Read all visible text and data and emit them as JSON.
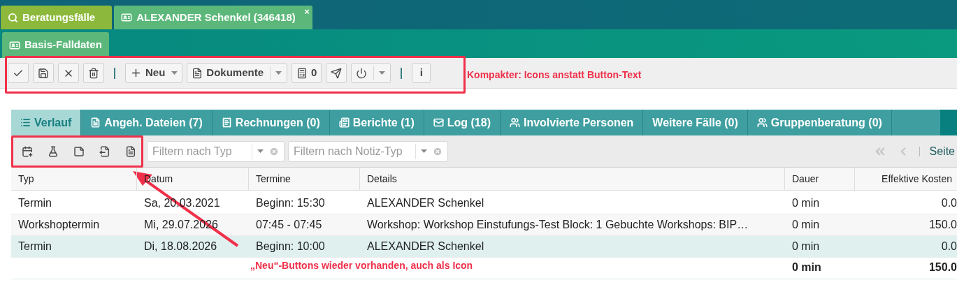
{
  "top_tabs": [
    {
      "label": "Beratungsfälle",
      "color": "#8cb93b"
    },
    {
      "label": "ALEXANDER Schenkel (346418)",
      "color": "#5cb87a",
      "close": "×"
    }
  ],
  "sub_tab": {
    "label": "Basis-Falldaten"
  },
  "toolbar": [
    {
      "kind": "button"
    },
    {
      "kind": "button"
    },
    {
      "kind": "button"
    },
    {
      "kind": "button"
    },
    {
      "kind": "separator"
    },
    {
      "kind": "dropdown",
      "label": "Neu"
    },
    {
      "kind": "split",
      "label": "Dokumente"
    },
    {
      "kind": "button",
      "label": "0"
    },
    {
      "kind": "button"
    },
    {
      "kind": "split"
    },
    {
      "kind": "separator"
    },
    {
      "kind": "button",
      "label": "i"
    }
  ],
  "section_tabs": [
    {
      "label": "Verlauf",
      "selected": true
    },
    {
      "label": "Angeh. Dateien (7)",
      "selected": false
    },
    {
      "label": "Rechnungen (0)",
      "selected": false
    },
    {
      "label": "Berichte (1)",
      "selected": false
    },
    {
      "label": "Log (18)",
      "selected": false
    },
    {
      "label": "Involvierte Personen",
      "selected": false
    },
    {
      "label": "Weitere Fälle (0)",
      "selected": false
    },
    {
      "label": "Gruppenberatung (0)",
      "selected": false
    }
  ],
  "filters": [
    {
      "placeholder": "Filtern nach Typ"
    },
    {
      "placeholder": "Filtern nach Notiz-Typ"
    }
  ],
  "paging": {
    "label": "Seite"
  },
  "table": {
    "columns": [
      "Typ",
      "Datum",
      "Termine",
      "Details",
      "Dauer",
      "Effektive Kosten"
    ],
    "rows": [
      {
        "cells": [
          "Termin",
          "Sa, 20.03.2021",
          "Beginn: 15:30",
          "ALEXANDER Schenkel",
          "0 min",
          "0.0"
        ],
        "selected": false
      },
      {
        "cells": [
          "Workshoptermin",
          "Mi, 29.07.2026",
          "07:45 - 07:45",
          "Workshop: Workshop Einstufungs-Test Block: 1 Gebuchte Workshops: BIP…",
          "0 min",
          "150.0"
        ],
        "selected": false
      },
      {
        "cells": [
          "Termin",
          "Di, 18.08.2026",
          "Beginn: 10:00",
          "ALEXANDER Schenkel",
          "0 min",
          "0.0"
        ],
        "selected": true
      }
    ],
    "total": {
      "duration": "0 min",
      "cost": "150.0"
    }
  },
  "annotations": [
    {
      "text": "Kompakter: Icons anstatt Button-Text"
    },
    {
      "text": "„Neu“-Buttons wieder vorhanden, auch als Icon"
    }
  ]
}
